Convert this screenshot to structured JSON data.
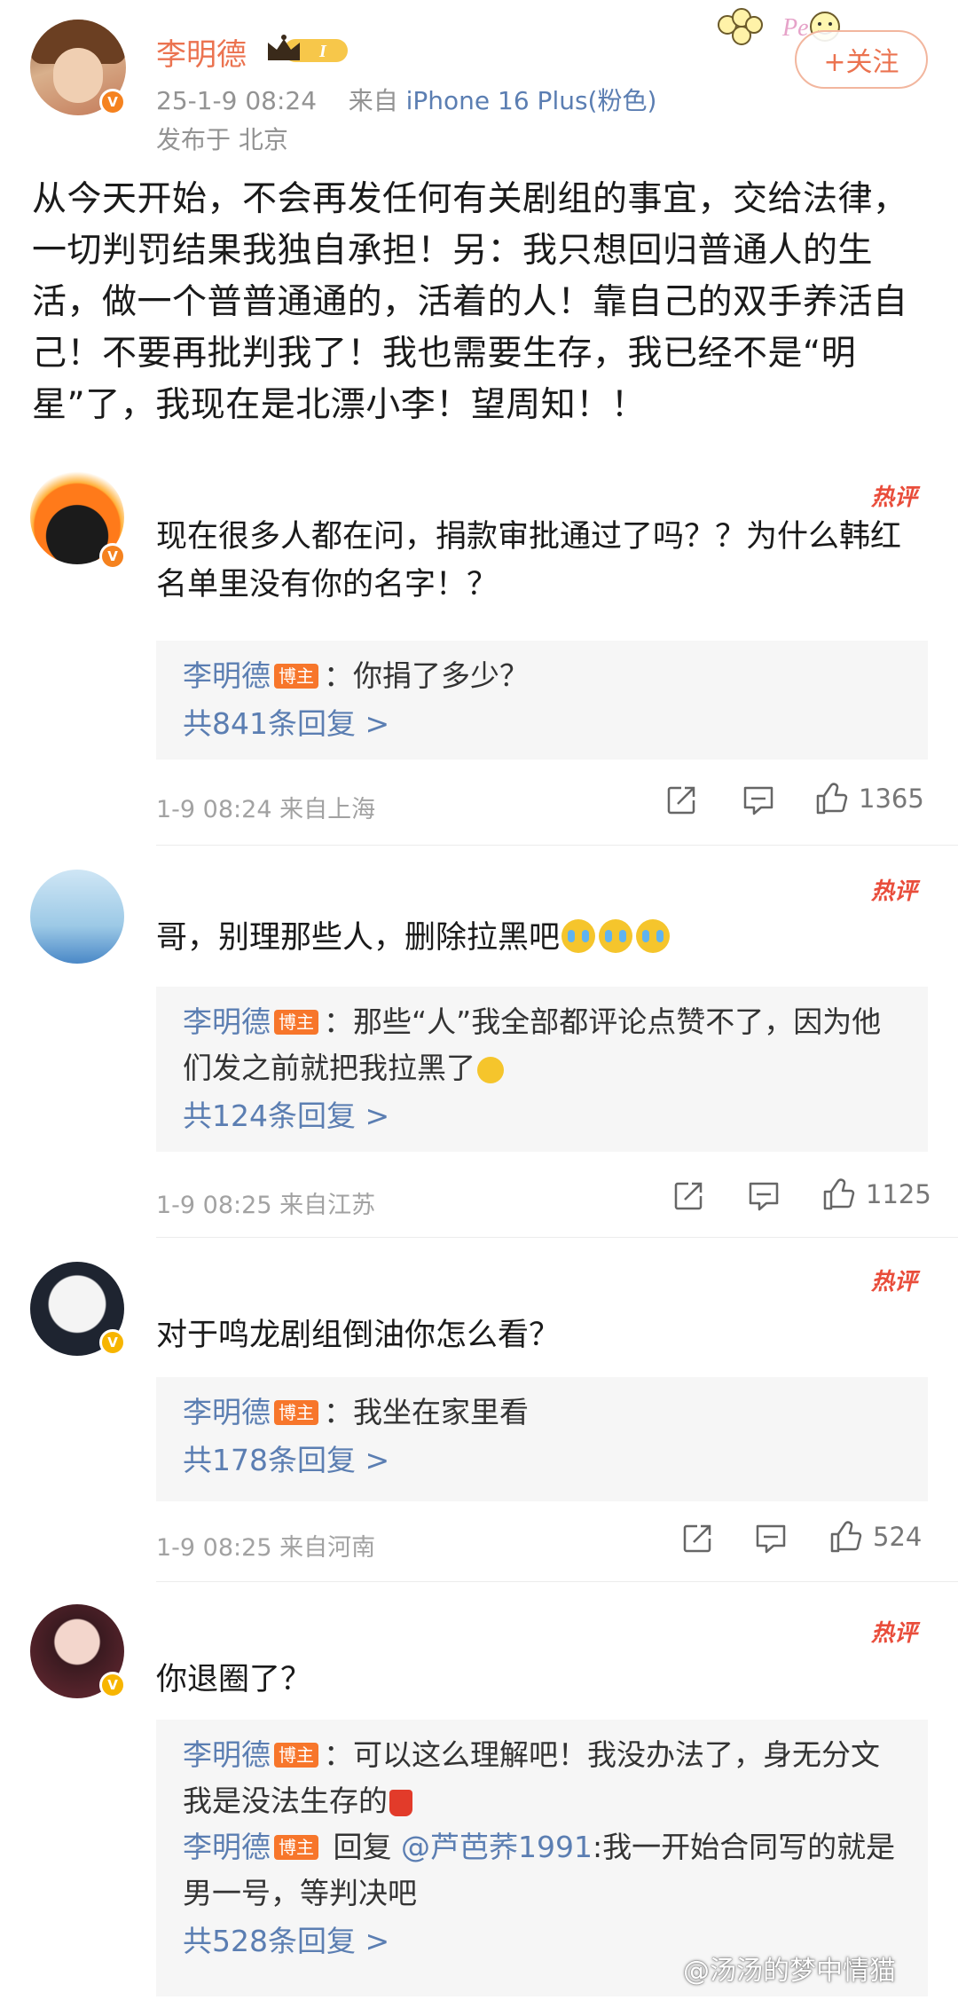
{
  "post": {
    "author": "李明德",
    "timestamp": "25-1-9 08:24",
    "source_prefix": "来自",
    "source": "iPhone 16 Plus(粉色)",
    "location": "发布于 北京",
    "follow_label": "+关注",
    "level_badge": "I",
    "text": "从今天开始，不会再发任何有关剧组的事宜，交给法律，一切判罚结果我独自承担！另：我只想回归普通人的生活，做一个普普通通的，活着的人！靠自己的双手养活自己！不要再批判我了！我也需要生存，我已经不是“明星”了，我现在是北漂小李！望周知！！"
  },
  "comments": [
    {
      "hot_label": "热评",
      "text": "现在很多人都在问，捐款审批通过了吗？？为什么韩红名单里没有你的名字！？",
      "replies": [
        {
          "name": "李明德",
          "tag": "博主",
          "text": "：你捐了多少？"
        }
      ],
      "reply_count": "共841条回复 >",
      "meta": "1-9 08:24  来自上海",
      "likes": "1365"
    },
    {
      "hot_label": "热评",
      "text": "哥，别理那些人，删除拉黑吧",
      "replies": [
        {
          "name": "李明德",
          "tag": "博主",
          "text": "：那些“人”我全部都评论点赞不了，因为他们发之前就把我拉黑了"
        }
      ],
      "reply_count": "共124条回复 >",
      "meta": "1-9 08:25  来自江苏",
      "likes": "1125"
    },
    {
      "hot_label": "热评",
      "text": "对于鸣龙剧组倒油你怎么看？",
      "replies": [
        {
          "name": "李明德",
          "tag": "博主",
          "text": "：我坐在家里看"
        }
      ],
      "reply_count": "共178条回复 >",
      "meta": "1-9 08:25  来自河南",
      "likes": "524"
    },
    {
      "hot_label": "热评",
      "text": "你退圈了？",
      "replies": [
        {
          "name": "李明德",
          "tag": "博主",
          "text": "：可以这么理解吧！我没办法了，身无分文我是没法生存的"
        },
        {
          "name": "李明德",
          "tag": "博主",
          "reply_word": " 回复 ",
          "mention": "@芦芭荞1991",
          "text": ":我一开始合同写的就是男一号，等判决吧"
        }
      ],
      "reply_count": "共528条回复 >"
    }
  ],
  "watermark": "@汤汤的梦中情猫",
  "colors": {
    "name_orange": "#eb7350",
    "link_blue": "#5b7eb2",
    "hot_red": "#e94d3b",
    "boss_tag": "#f7762b",
    "meta_gray": "#a2a2a2"
  },
  "icons": [
    "verified-badge-icon",
    "crown-level-icon",
    "repost-icon",
    "comment-icon",
    "like-icon",
    "crying-emoji-icon",
    "fries-emoji-icon"
  ]
}
